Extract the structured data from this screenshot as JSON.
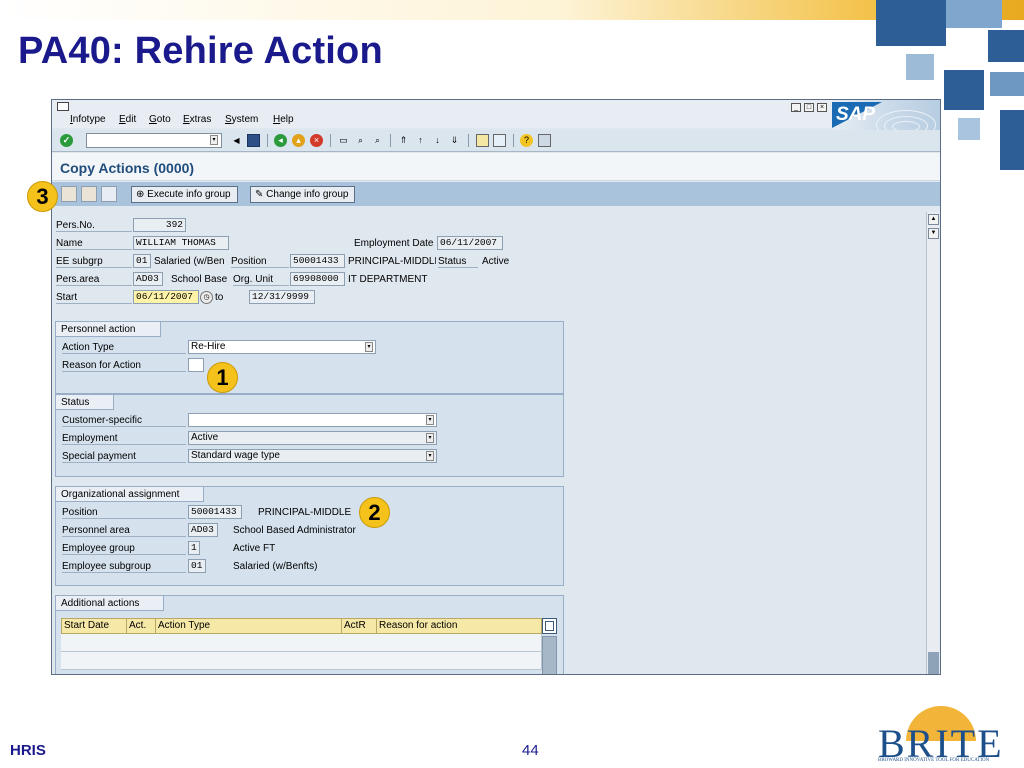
{
  "slide": {
    "title": "PA40: Rehire Action",
    "footer_left": "HRIS",
    "page_number": "44",
    "brite_logo": "BRITE",
    "brite_tagline": "BROWARD INNOVATIVE TOOL FOR EDUCATION"
  },
  "sap": {
    "menu": [
      "Infotype",
      "Edit",
      "Goto",
      "Extras",
      "System",
      "Help"
    ],
    "logo": "SAP",
    "screen_title": "Copy Actions (0000)",
    "buttons": {
      "execute_info_group": "Execute info group",
      "change_info_group": "Change info group"
    },
    "header": {
      "pers_no_label": "Pers.No.",
      "pers_no": "392",
      "name_label": "Name",
      "name": "WILLIAM THOMAS",
      "employment_date_label": "Employment Date",
      "employment_date": "06/11/2007",
      "ee_subgrp_label": "EE subgrp",
      "ee_subgrp": "01",
      "ee_subgrp_text": "Salaried (w/Ben",
      "position_label": "Position",
      "position": "50001433",
      "position_text": "PRINCIPAL-MIDDLE",
      "status_label": "Status",
      "status": "Active",
      "pers_area_label": "Pers.area",
      "pers_area": "AD03",
      "pers_area_text": "School Base",
      "org_unit_label": "Org. Unit",
      "org_unit": "69908000",
      "org_unit_text": "IT DEPARTMENT",
      "start_label": "Start",
      "start": "06/11/2007",
      "to_label": "to",
      "end": "12/31/9999"
    },
    "personnel_action": {
      "title": "Personnel action",
      "action_type_label": "Action Type",
      "action_type": "Re-Hire",
      "reason_label": "Reason for Action",
      "reason": ""
    },
    "status_group": {
      "title": "Status",
      "customer_specific_label": "Customer-specific",
      "customer_specific": "",
      "employment_label": "Employment",
      "employment": "Active",
      "special_payment_label": "Special payment",
      "special_payment": "Standard wage type"
    },
    "org_assignment": {
      "title": "Organizational assignment",
      "position_label": "Position",
      "position": "50001433",
      "position_text": "PRINCIPAL-MIDDLE",
      "personnel_area_label": "Personnel area",
      "personnel_area": "AD03",
      "personnel_area_text": "School Based Administrator",
      "employee_group_label": "Employee group",
      "employee_group": "1",
      "employee_group_text": "Active FT",
      "employee_subgroup_label": "Employee subgroup",
      "employee_subgroup": "01",
      "employee_subgroup_text": "Salaried (w/Benfts)"
    },
    "additional_actions": {
      "title": "Additional actions",
      "columns": [
        "Start Date",
        "Act.",
        "Action Type",
        "ActR",
        "Reason for action"
      ]
    }
  },
  "callouts": [
    "1",
    "2",
    "3"
  ],
  "colors": {
    "title_blue": "#1a1a8c",
    "callout_yellow": "#f5c21b",
    "sap_app_toolbar": "#a9c3dd",
    "table_header": "#f6e8a7"
  }
}
